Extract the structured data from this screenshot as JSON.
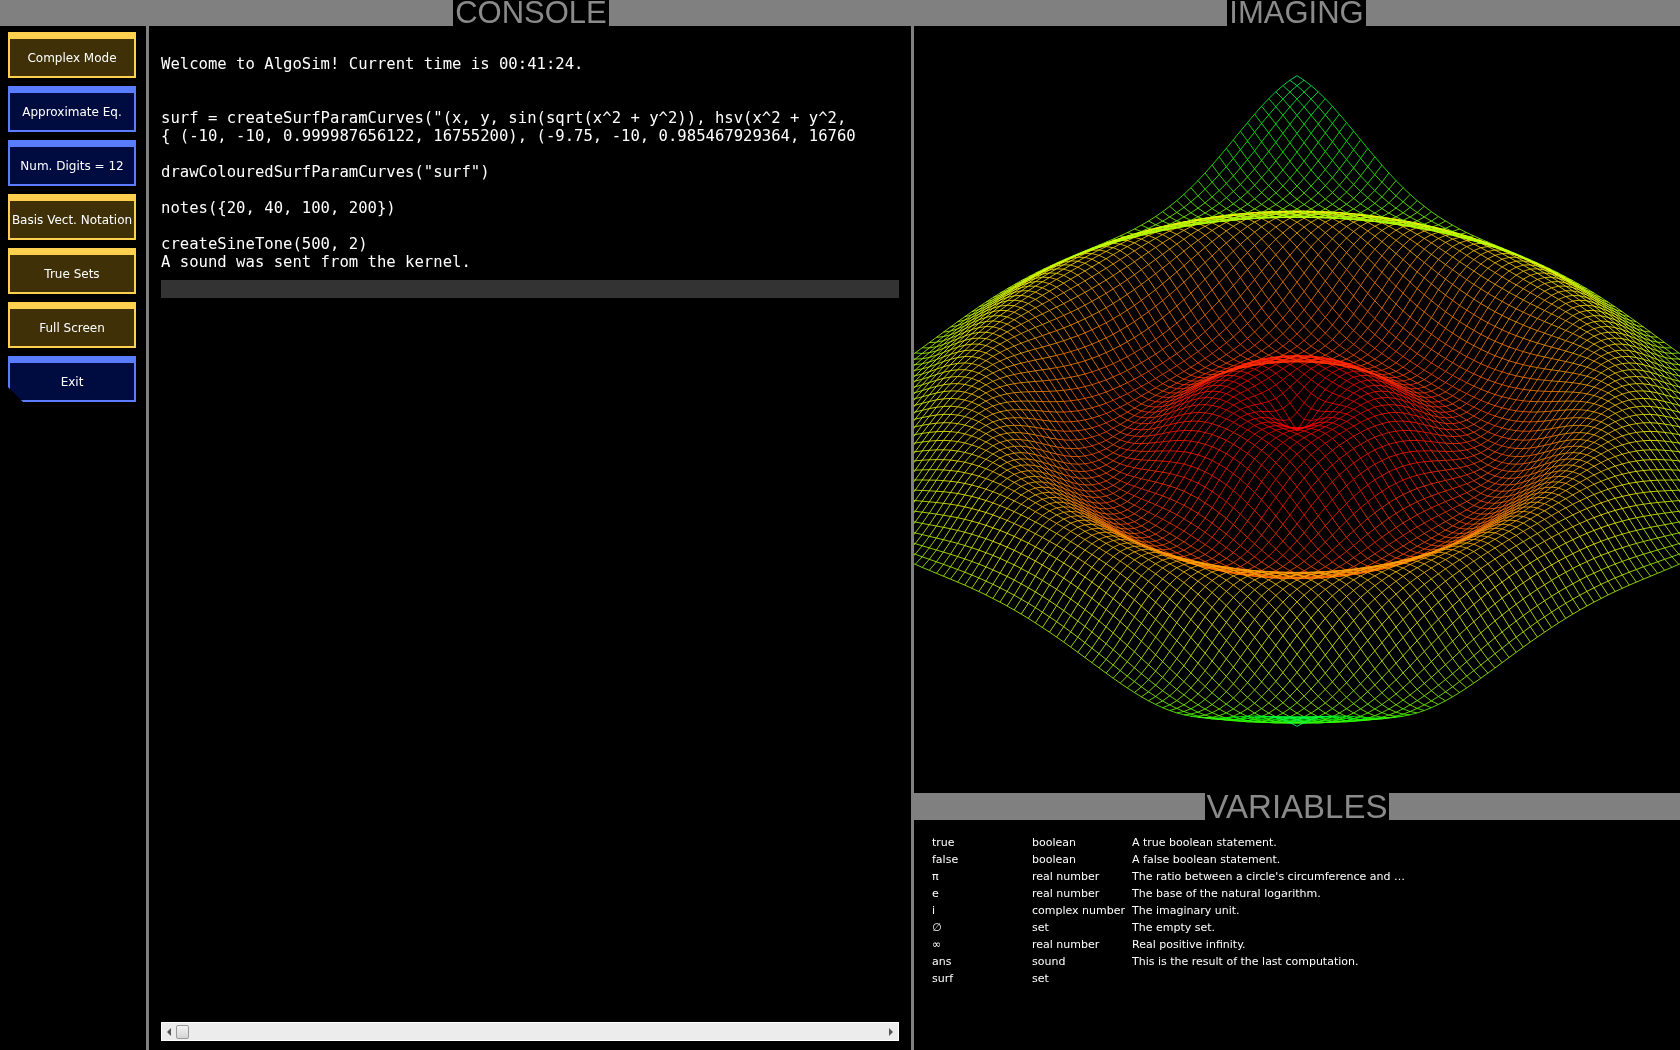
{
  "sidebar": {
    "buttons": [
      {
        "label": "Complex Mode",
        "kind": "toggle"
      },
      {
        "label": "Approximate Eq.",
        "kind": "setting"
      },
      {
        "label": "Num. Digits = 12",
        "kind": "setting"
      },
      {
        "label": "Basis Vect. Notation",
        "kind": "toggle"
      },
      {
        "label": "True Sets",
        "kind": "toggle"
      },
      {
        "label": "Full Screen",
        "kind": "toggle"
      },
      {
        "label": "Exit",
        "kind": "exit"
      }
    ]
  },
  "console": {
    "title": "CONSOLE",
    "lines": [
      {
        "kind": "output",
        "text": "Welcome to AlgoSim! Current time is 00:41:24."
      },
      {
        "kind": "blank"
      },
      {
        "kind": "blank"
      },
      {
        "kind": "input",
        "text": "surf = createSurfParamCurves(\"(x, y, sin(sqrt(x^2 + y^2)), hsv(x^2 + y^2,"
      },
      {
        "kind": "output",
        "text": "{ (-10, -10, 0.999987656122, 16755200), (-9.75, -10, 0.985467929364, 16760"
      },
      {
        "kind": "blank"
      },
      {
        "kind": "input",
        "text": "drawColouredSurfParamCurves(\"surf\")"
      },
      {
        "kind": "blank"
      },
      {
        "kind": "input",
        "text": "notes({20, 40, 100, 200})"
      },
      {
        "kind": "blank"
      },
      {
        "kind": "input",
        "text": "createSineTone(500, 2)"
      },
      {
        "kind": "output",
        "text": "A sound was sent from the kernel."
      }
    ]
  },
  "imaging": {
    "title": "IMAGING"
  },
  "variables": {
    "title": "VARIABLES",
    "rows": [
      {
        "name": "true",
        "type": "boolean",
        "description": "A true boolean statement."
      },
      {
        "name": "false",
        "type": "boolean",
        "description": "A false boolean statement."
      },
      {
        "name": "π",
        "type": "real number",
        "description": "The ratio between a circle's circumference and …"
      },
      {
        "name": "e",
        "type": "real number",
        "description": "The base of the natural logarithm."
      },
      {
        "name": "i",
        "type": "complex number",
        "description": "The imaginary unit."
      },
      {
        "name": "∅",
        "type": "set",
        "description": "The empty set."
      },
      {
        "name": "∞",
        "type": "real number",
        "description": "Real positive infinity."
      },
      {
        "name": "ans",
        "type": "sound",
        "description": "This is the result of the last computation."
      },
      {
        "name": "surf",
        "type": "set"
      }
    ]
  }
}
